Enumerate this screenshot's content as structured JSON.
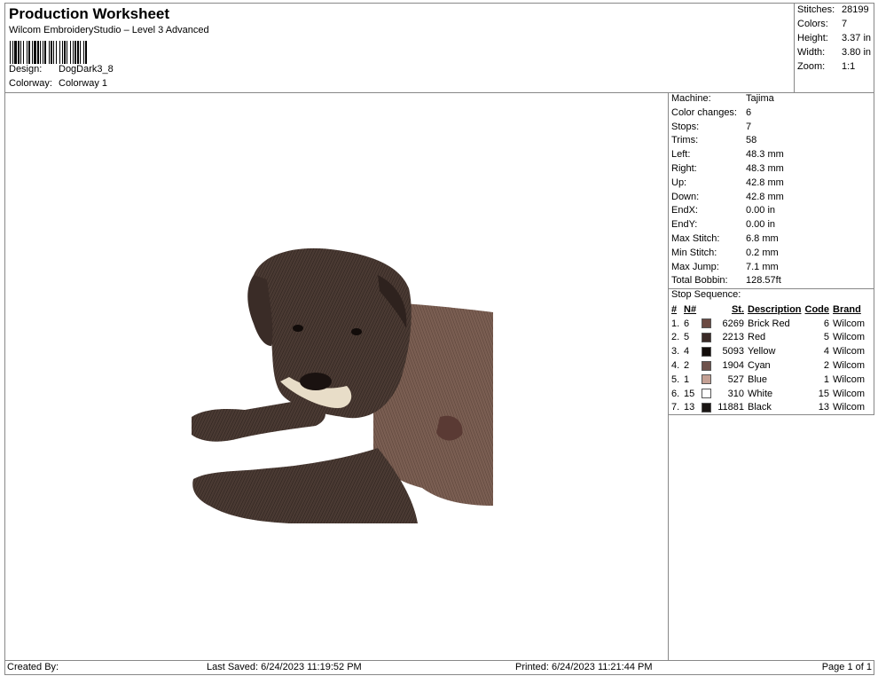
{
  "header": {
    "title": "Production Worksheet",
    "subtitle": "Wilcom EmbroideryStudio – Level 3 Advanced",
    "design_label": "Design:",
    "design_value": "DogDark3_8",
    "colorway_label": "Colorway:",
    "colorway_value": "Colorway 1"
  },
  "summary": [
    {
      "label": "Stitches:",
      "value": "28199"
    },
    {
      "label": "Colors:",
      "value": "7"
    },
    {
      "label": "Height:",
      "value": "3.37 in"
    },
    {
      "label": "Width:",
      "value": "3.80 in"
    },
    {
      "label": "Zoom:",
      "value": "1:1"
    }
  ],
  "machine_info": [
    {
      "label": "Machine:",
      "value": "Tajima"
    },
    {
      "label": "Color changes:",
      "value": "6"
    },
    {
      "label": "Stops:",
      "value": "7"
    },
    {
      "label": "Trims:",
      "value": "58"
    },
    {
      "label": "Left:",
      "value": "48.3 mm"
    },
    {
      "label": "Right:",
      "value": "48.3 mm"
    },
    {
      "label": "Up:",
      "value": "42.8 mm"
    },
    {
      "label": "Down:",
      "value": "42.8 mm"
    },
    {
      "label": "EndX:",
      "value": "0.00 in"
    },
    {
      "label": "EndY:",
      "value": "0.00 in"
    },
    {
      "label": "Max Stitch:",
      "value": "6.8 mm"
    },
    {
      "label": "Min Stitch:",
      "value": "0.2 mm"
    },
    {
      "label": "Max Jump:",
      "value": "7.1 mm"
    },
    {
      "label": "Total Bobbin:",
      "value": "128.57ft"
    }
  ],
  "stop_sequence": {
    "title": "Stop Sequence:",
    "headers": [
      "#",
      "N#",
      "St.",
      "Description",
      "Code",
      "Brand"
    ],
    "rows": [
      {
        "num": "1.",
        "n": "6",
        "color": "#6b4a42",
        "st": "6269",
        "desc": "Brick Red",
        "code": "6",
        "brand": "Wilcom"
      },
      {
        "num": "2.",
        "n": "5",
        "color": "#3a2a27",
        "st": "2213",
        "desc": "Red",
        "code": "5",
        "brand": "Wilcom"
      },
      {
        "num": "3.",
        "n": "4",
        "color": "#120c0a",
        "st": "5093",
        "desc": "Yellow",
        "code": "4",
        "brand": "Wilcom"
      },
      {
        "num": "4.",
        "n": "2",
        "color": "#6e524c",
        "st": "1904",
        "desc": "Cyan",
        "code": "2",
        "brand": "Wilcom"
      },
      {
        "num": "5.",
        "n": "1",
        "color": "#c4a094",
        "st": "527",
        "desc": "Blue",
        "code": "1",
        "brand": "Wilcom"
      },
      {
        "num": "6.",
        "n": "15",
        "color": "#ffffff",
        "st": "310",
        "desc": "White",
        "code": "15",
        "brand": "Wilcom"
      },
      {
        "num": "7.",
        "n": "13",
        "color": "#1a1614",
        "st": "11881",
        "desc": "Black",
        "code": "13",
        "brand": "Wilcom"
      }
    ]
  },
  "footer": {
    "created_by": "Created By:",
    "last_saved": "Last Saved: 6/24/2023 11:19:52 PM",
    "printed": "Printed: 6/24/2023 11:21:44 PM",
    "page": "Page 1 of 1"
  }
}
